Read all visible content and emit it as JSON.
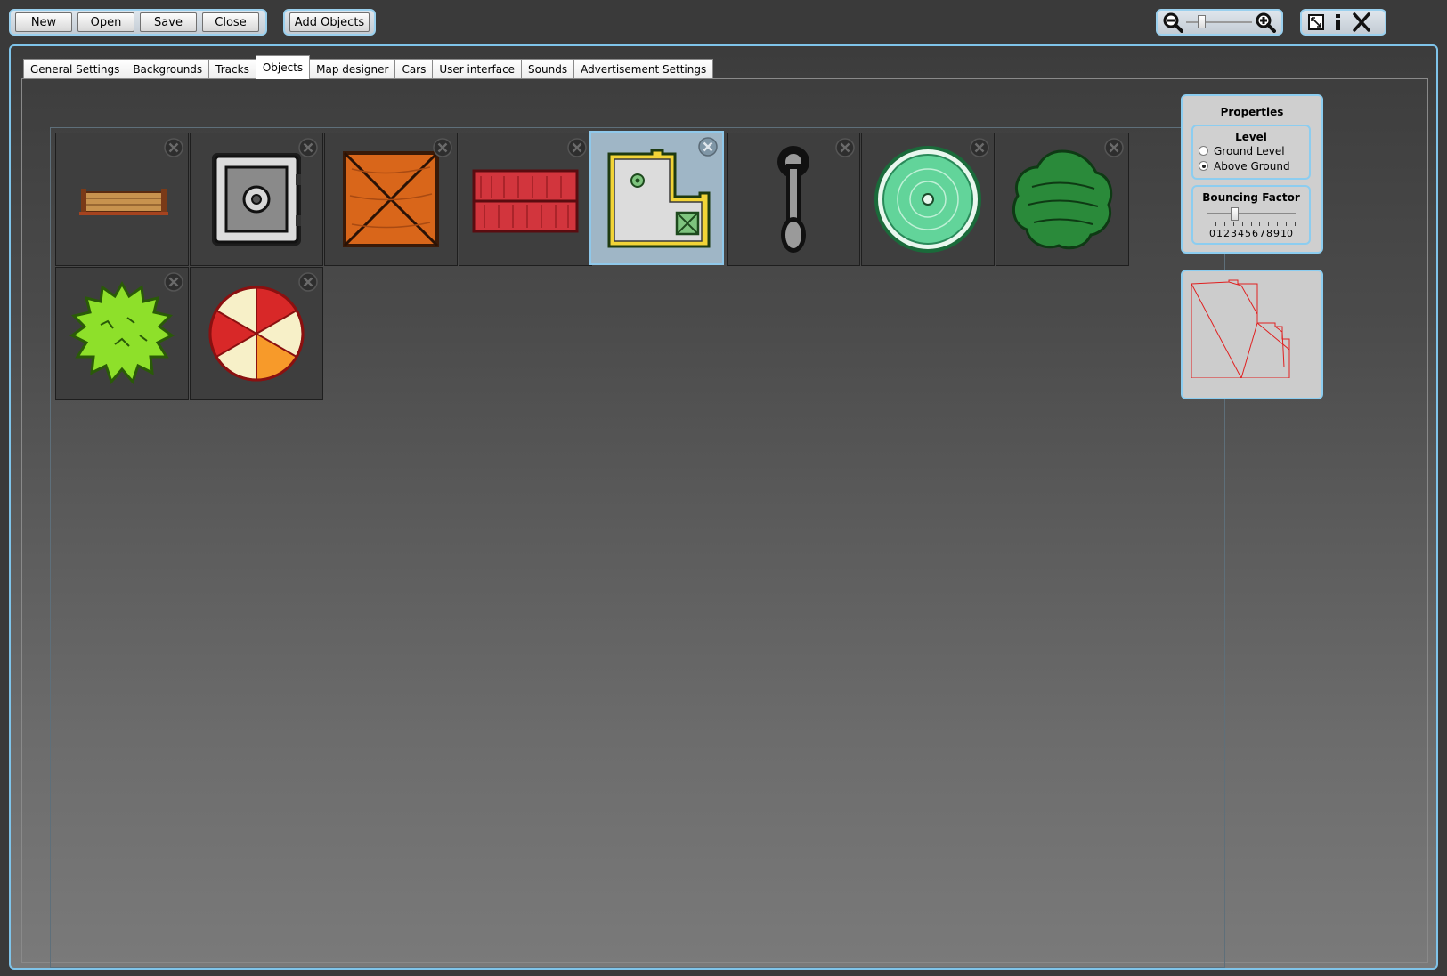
{
  "toolbar": {
    "new_label": "New",
    "open_label": "Open",
    "save_label": "Save",
    "close_label": "Close",
    "add_objects_label": "Add Objects"
  },
  "zoom": {
    "level": 0.2
  },
  "tabs": [
    {
      "label": "General Settings"
    },
    {
      "label": "Backgrounds"
    },
    {
      "label": "Tracks"
    },
    {
      "label": "Objects"
    },
    {
      "label": "Map designer"
    },
    {
      "label": "Cars"
    },
    {
      "label": "User interface"
    },
    {
      "label": "Sounds"
    },
    {
      "label": "Advertisement Settings"
    }
  ],
  "active_tab": "Objects",
  "objects": [
    {
      "name": "wooden-bench",
      "selected": false
    },
    {
      "name": "metal-safe",
      "selected": false
    },
    {
      "name": "orange-crate",
      "selected": false
    },
    {
      "name": "red-wood-block",
      "selected": false
    },
    {
      "name": "l-shaped-building",
      "selected": true
    },
    {
      "name": "pole-post",
      "selected": false
    },
    {
      "name": "green-round-platform",
      "selected": false
    },
    {
      "name": "dark-green-bush",
      "selected": false
    },
    {
      "name": "lime-spiky-bush",
      "selected": false
    },
    {
      "name": "striped-beach-ball",
      "selected": false
    }
  ],
  "properties": {
    "title": "Properties",
    "level": {
      "title": "Level",
      "options": [
        "Ground Level",
        "Above Ground"
      ],
      "selected": "Above Ground"
    },
    "bouncing": {
      "title": "Bouncing Factor",
      "ticks": [
        "0",
        "1",
        "2",
        "3",
        "4",
        "5",
        "6",
        "7",
        "8",
        "9",
        "10"
      ],
      "value": 3
    }
  },
  "colors": {
    "accent": "#8ccdf0",
    "selected_tile": "#9fb6c6",
    "outline_preview": "#e02020"
  }
}
